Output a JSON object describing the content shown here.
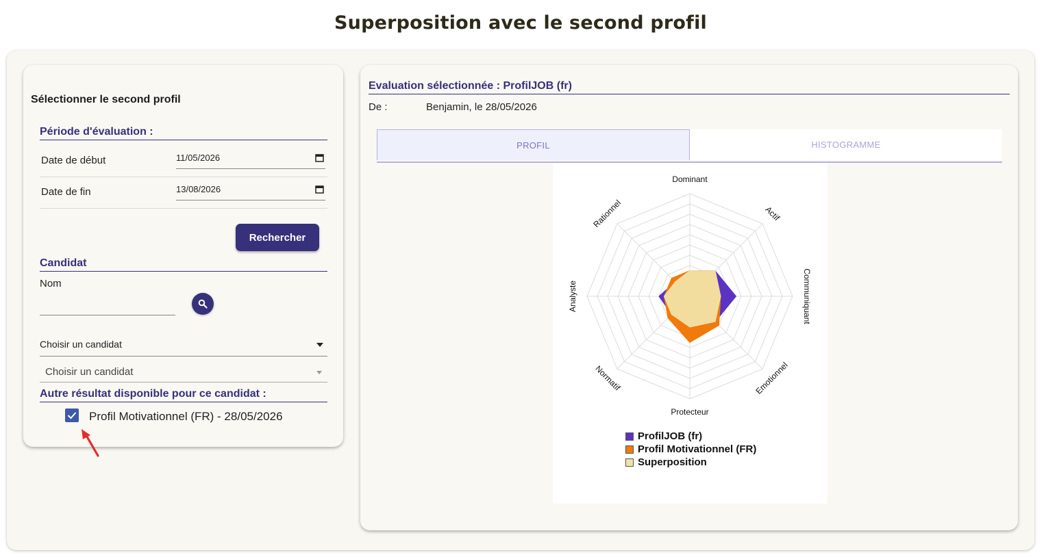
{
  "page": {
    "title": "Superposition avec le second profil"
  },
  "left": {
    "heading": "Sélectionner le second profil",
    "period_title": "Période d'évaluation :",
    "start_label": "Date de début",
    "start_value": "11/05/2026",
    "end_label": "Date de fin",
    "end_value": "13/08/2026",
    "search_button": "Rechercher",
    "candidate_title": "Candidat",
    "name_label": "Nom",
    "name_value": "",
    "select_candidate_1": "Choisir un candidat",
    "select_candidate_2": "Choisir un candidat",
    "other_results_title": "Autre résultat disponible pour ce candidat :",
    "other_result_label": "Profil Motivationnel (FR) - 28/05/2026",
    "other_result_checked": true
  },
  "right": {
    "title": "Evaluation sélectionnée : ProfilJOB (fr)",
    "from_label": "De :",
    "from_value": "Benjamin, le 28/05/2026",
    "tabs": [
      {
        "label": "PROFIL",
        "active": true
      },
      {
        "label": "HISTOGRAMME",
        "active": false
      }
    ]
  },
  "chart_data": {
    "type": "radar",
    "axes": [
      "Dominant",
      "Actif",
      "Communiquant",
      "Emotionnel",
      "Protecteur",
      "Normatif",
      "Analyste",
      "Rationnel"
    ],
    "max": 10,
    "rings": 10,
    "series": [
      {
        "name": "ProfilJOB (fr)",
        "color": "#5b33c2",
        "values": [
          2.5,
          3.5,
          4.5,
          3.5,
          3.0,
          2.5,
          3.0,
          2.0
        ]
      },
      {
        "name": "Profil Motivationnel (FR)",
        "color": "#f07a0c",
        "values": [
          2.5,
          3.5,
          3.0,
          4.0,
          4.5,
          3.0,
          2.5,
          2.5
        ]
      },
      {
        "name": "Superposition",
        "color": "#f1e2a6",
        "values": [
          2.5,
          3.5,
          3.0,
          3.5,
          3.0,
          2.5,
          2.5,
          2.0
        ]
      }
    ]
  }
}
